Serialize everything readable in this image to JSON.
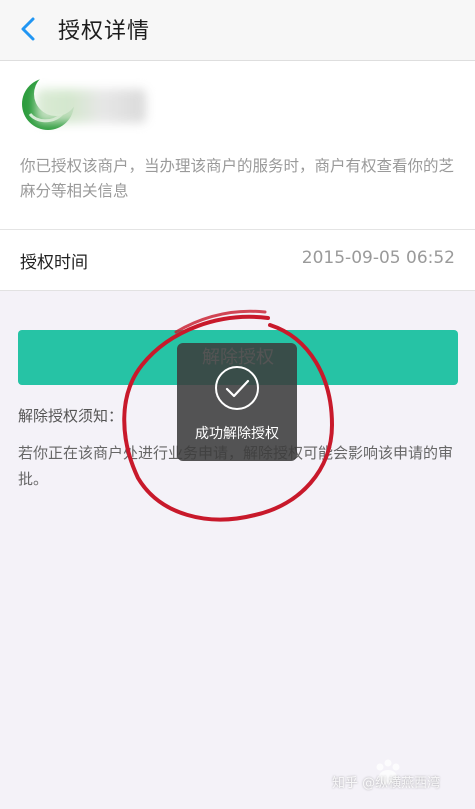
{
  "header": {
    "back_icon": "chevron-left-icon",
    "title": "授权详情"
  },
  "merchant": {
    "logo_icon": "merchant-logo-icon",
    "notice": "你已授权该商户，当办理该商户的服务时，商户有权查看你的芝麻分等相关信息"
  },
  "authorization": {
    "time_label": "授权时间",
    "time_value": "2015-09-05 06:52"
  },
  "actions": {
    "revoke_button": "解除授权"
  },
  "notes": {
    "title": "解除授权须知：",
    "body": "若你正在该商户处进行业务申请，解除授权可能会影响该申请的审批。"
  },
  "toast": {
    "icon": "check-circle-icon",
    "message": "成功解除授权"
  },
  "overlay": {
    "watermark": "知乎 @纵横燕西湾",
    "brand_icon": "baidu-paw-icon"
  },
  "colors": {
    "accent": "#26c3a5",
    "back_icon": "#2196f3",
    "annotation": "#c8192b"
  }
}
